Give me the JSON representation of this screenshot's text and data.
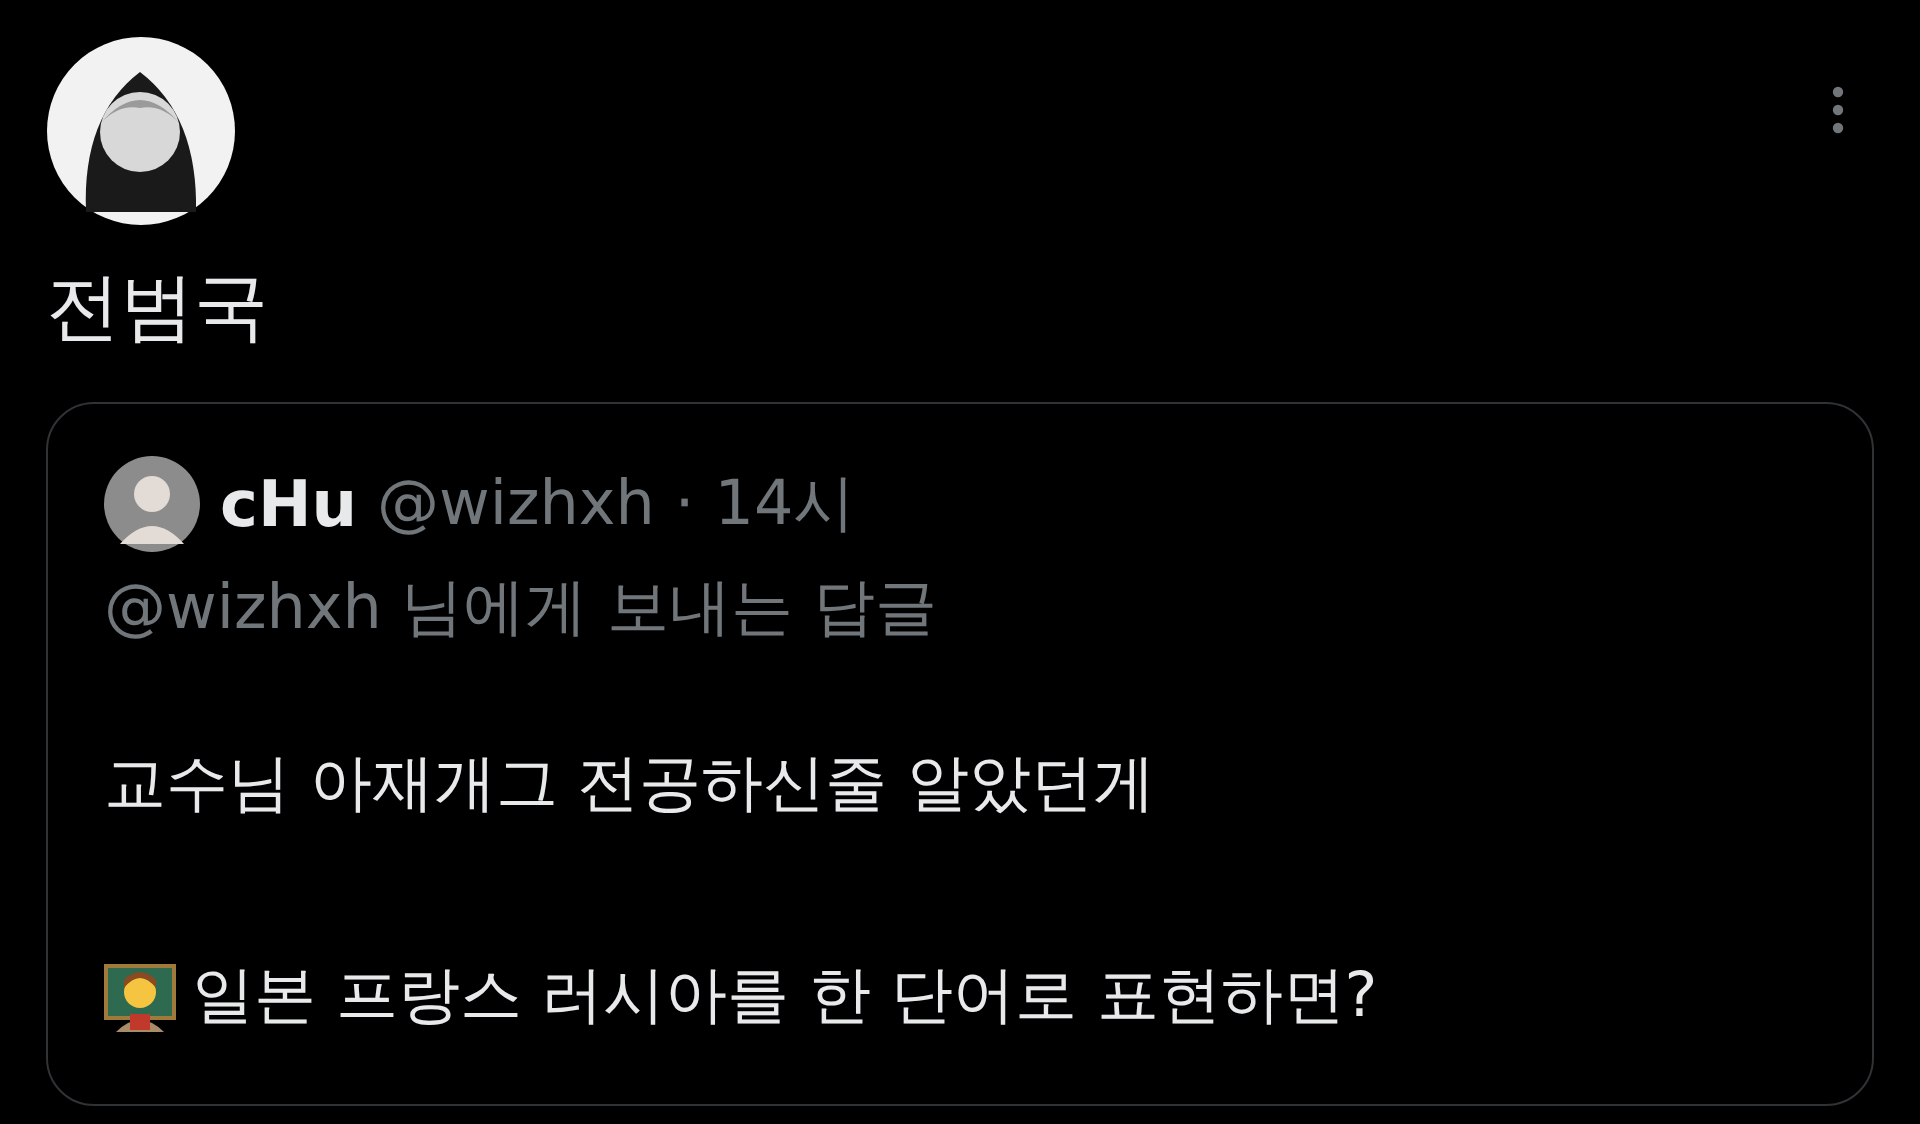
{
  "post": {
    "text": "전범국",
    "quote": {
      "author": {
        "name": "cHu",
        "handle": "@wizhxh",
        "separator": "·",
        "time": "14시"
      },
      "reply_to": "@wizhxh 님에게 보내는 답글",
      "paragraphs": [
        {
          "kind": "text",
          "text": "교수님 아재개그 전공하신줄 알았던게"
        },
        {
          "kind": "teacher",
          "text": "일본 프랑스 러시아를 한 단어로 표현하면?"
        }
      ]
    }
  }
}
